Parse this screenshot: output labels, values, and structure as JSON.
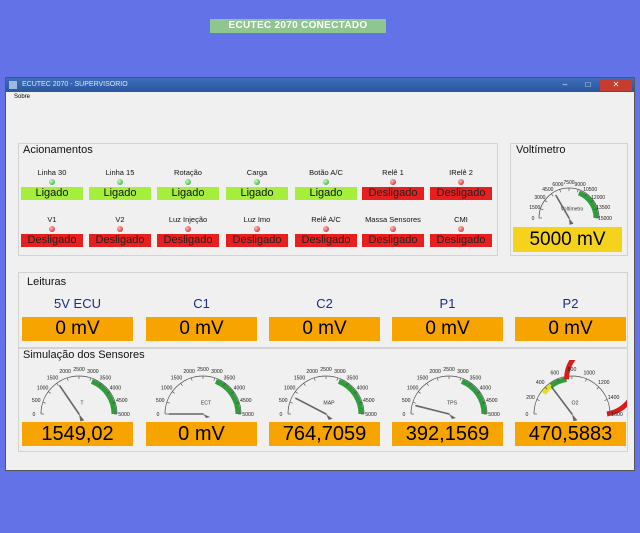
{
  "window": {
    "title": "ECUTEC 2070 - SUPERVISORIO",
    "minimize": "–",
    "maximize": "□",
    "close": "✕"
  },
  "menu": {
    "item": "Sobre"
  },
  "connection_status": "ECUTEC 2070 CONECTADO",
  "acionamentos": {
    "title": "Acionamentos",
    "row1": [
      {
        "label": "Linha 30",
        "state": "Ligado",
        "on": true
      },
      {
        "label": "Linha 15",
        "state": "Ligado",
        "on": true
      },
      {
        "label": "Rotação",
        "state": "Ligado",
        "on": true
      },
      {
        "label": "Carga",
        "state": "Ligado",
        "on": true
      },
      {
        "label": "Botão A/C",
        "state": "Ligado",
        "on": true
      },
      {
        "label": "Relê 1",
        "state": "Desligado",
        "on": false
      },
      {
        "label": "IRelê 2",
        "state": "Desligado",
        "on": false
      }
    ],
    "row2": [
      {
        "label": "V1",
        "state": "Desligado",
        "on": false
      },
      {
        "label": "V2",
        "state": "Desligado",
        "on": false
      },
      {
        "label": "Luz Injeção",
        "state": "Desligado",
        "on": false
      },
      {
        "label": "Luz Imo",
        "state": "Desligado",
        "on": false
      },
      {
        "label": "Relê A/C",
        "state": "Desligado",
        "on": false
      },
      {
        "label": "Massa Sensores",
        "state": "Desligado",
        "on": false
      },
      {
        "label": "CMI",
        "state": "Desligado",
        "on": false
      }
    ]
  },
  "voltimetro": {
    "title": "Voltímetro",
    "gauge_label": "Voltímetro",
    "ticks": [
      "0",
      "1500",
      "3000",
      "4500",
      "6000",
      "7500",
      "9000",
      "10500",
      "12000",
      "13500",
      "15000"
    ],
    "max": 15000,
    "value": 5000,
    "display": "5000 mV"
  },
  "leituras": {
    "title": "Leituras",
    "channels": [
      {
        "label": "5V ECU",
        "value": "0 mV"
      },
      {
        "label": "C1",
        "value": "0 mV"
      },
      {
        "label": "C2",
        "value": "0 mV"
      },
      {
        "label": "P1",
        "value": "0 mV"
      },
      {
        "label": "P2",
        "value": "0 mV"
      }
    ]
  },
  "simulacao": {
    "title": "Simulação dos Sensores",
    "gauges": [
      {
        "name": "T",
        "ticks": [
          "0",
          "500",
          "1000",
          "1500",
          "2000",
          "2500",
          "3000",
          "3500",
          "4000",
          "4500",
          "5000"
        ],
        "max": 5000,
        "value": 1549.02,
        "display": "1549,02",
        "zones": "green"
      },
      {
        "name": "ECT",
        "ticks": [
          "0",
          "500",
          "1000",
          "1500",
          "2000",
          "2500",
          "3000",
          "3500",
          "4000",
          "4500",
          "5000"
        ],
        "max": 5000,
        "value": 0,
        "display": "0 mV",
        "zones": "green"
      },
      {
        "name": "MAP",
        "ticks": [
          "0",
          "500",
          "1000",
          "1500",
          "2000",
          "2500",
          "3000",
          "3500",
          "4000",
          "4500",
          "5000"
        ],
        "max": 5000,
        "value": 764.7059,
        "display": "764,7059",
        "zones": "green"
      },
      {
        "name": "TPS",
        "ticks": [
          "0",
          "500",
          "1000",
          "1500",
          "2000",
          "2500",
          "3000",
          "3500",
          "4000",
          "4500",
          "5000"
        ],
        "max": 5000,
        "value": 392.1569,
        "display": "392,1569",
        "zones": "green"
      },
      {
        "name": "O2",
        "ticks": [
          "0",
          "200",
          "400",
          "600",
          "800",
          "1000",
          "1200",
          "1400",
          "1600"
        ],
        "max": 1600,
        "value": 470.5883,
        "display": "470,5883",
        "zones": "o2"
      }
    ]
  },
  "colors": {
    "green_zone": "#2f9e3a",
    "yellow_zone": "#e8e21c",
    "red_zone": "#d81c1c"
  }
}
